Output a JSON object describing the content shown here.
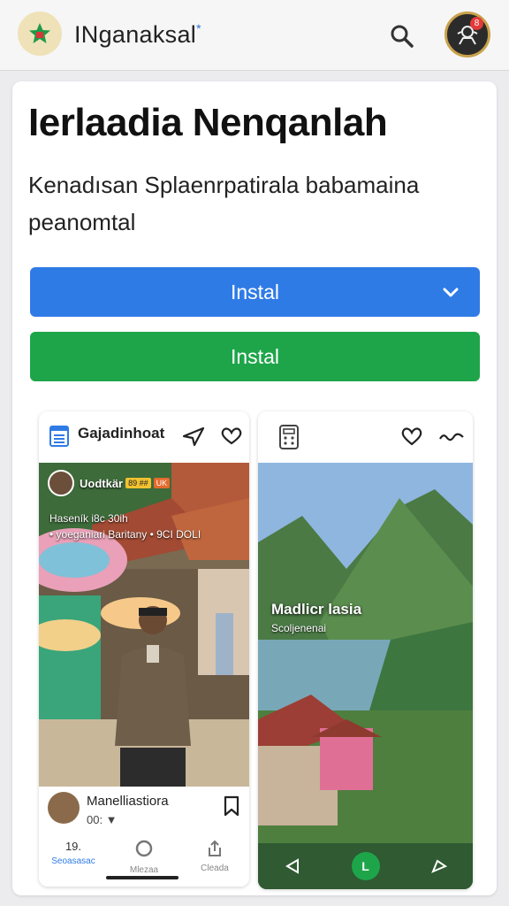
{
  "app": {
    "name": "INganaksal",
    "spark": "*",
    "logo_icon": "star-logo-icon",
    "avatar_badge": "8"
  },
  "hero": {
    "title": "Ierlaadia Nenqanlah",
    "description": "Kenadısan Splaenrpatirala babamaina peanomtal"
  },
  "buttons": {
    "primary_label": "Instal",
    "secondary_label": "Instal"
  },
  "post_left": {
    "title": "Gajadinhoat",
    "overlay_name": "Uodtkär",
    "tag_a": "89 ##",
    "tag_b": "UK",
    "overlay_line1": "Haseník i8c 30ih",
    "overlay_line2": "• yoeganiari Baritany • 9CI DOLI",
    "footer_name": "Manelliastiora",
    "footer_meta": "00: ▼",
    "tabs": [
      {
        "label": "Seoasasac",
        "number": "19."
      },
      {
        "label": "Mlezaa"
      },
      {
        "label": "Cleada"
      }
    ]
  },
  "post_right": {
    "title": "Madlicr lasia",
    "subtitle": "Scoljenenai",
    "play_label": "L"
  },
  "colors": {
    "primary_blue": "#2f7be6",
    "install_green": "#1ea54a",
    "badge_red": "#e23a3a"
  }
}
